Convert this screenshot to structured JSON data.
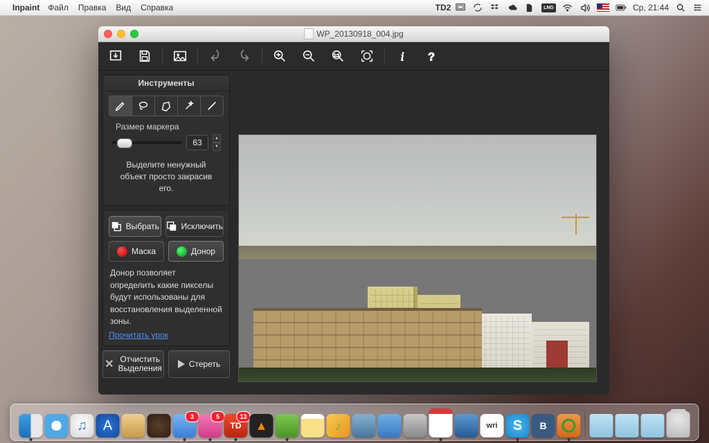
{
  "menubar": {
    "app_name": "Inpaint",
    "items": [
      "Файл",
      "Правка",
      "Вид",
      "Справка"
    ],
    "td_label": "2",
    "lang_label": "LNG",
    "clock": "Ср, 21:44"
  },
  "window": {
    "title": "WP_20130918_004.jpg"
  },
  "sidebar": {
    "tools_title": "Инструменты",
    "marker_size_label": "Размер маркера",
    "marker_size_value": "63",
    "hint": "Выделите ненужный объект просто закрасив его.",
    "select_label": "Выбрать",
    "exclude_label": "Исключить",
    "mask_label": "Маска",
    "donor_label": "Донор",
    "donor_desc": "Донор позволяет определить какие пикселы будут использованы для восстановления выделенной зоны.",
    "read_lesson": "Прочитать урок",
    "clear_line1": "Отчистить",
    "clear_line2": "Выделения",
    "erase_label": "Стереть"
  },
  "dock": {
    "badges": {
      "mail": "3",
      "slack": "5",
      "todo": "13"
    }
  }
}
